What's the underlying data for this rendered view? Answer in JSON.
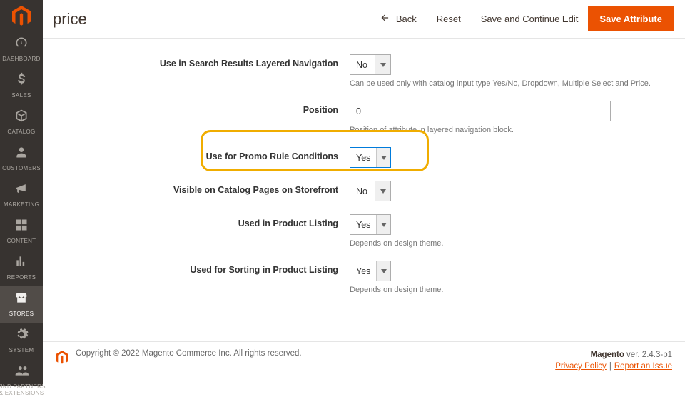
{
  "page": {
    "title": "price"
  },
  "topbar": {
    "back": "Back",
    "reset": "Reset",
    "save_continue": "Save and Continue Edit",
    "save": "Save Attribute"
  },
  "sidenav": [
    {
      "id": "dashboard",
      "label": "DASHBOARD"
    },
    {
      "id": "sales",
      "label": "SALES"
    },
    {
      "id": "catalog",
      "label": "CATALOG"
    },
    {
      "id": "customers",
      "label": "CUSTOMERS"
    },
    {
      "id": "marketing",
      "label": "MARKETING"
    },
    {
      "id": "content",
      "label": "CONTENT"
    },
    {
      "id": "reports",
      "label": "REPORTS"
    },
    {
      "id": "stores",
      "label": "STORES",
      "active": true
    },
    {
      "id": "system",
      "label": "SYSTEM"
    },
    {
      "id": "partners",
      "label": "FIND PARTNERS\n& EXTENSIONS"
    }
  ],
  "form": {
    "search_layered": {
      "label": "Use in Search Results Layered Navigation",
      "value": "No",
      "hint": "Can be used only with catalog input type Yes/No, Dropdown, Multiple Select and Price."
    },
    "position": {
      "label": "Position",
      "value": "0",
      "hint": "Position of attribute in layered navigation block."
    },
    "promo": {
      "label": "Use for Promo Rule Conditions",
      "value": "Yes"
    },
    "visible_catalog": {
      "label": "Visible on Catalog Pages on Storefront",
      "value": "No"
    },
    "product_listing": {
      "label": "Used in Product Listing",
      "value": "Yes",
      "hint": "Depends on design theme."
    },
    "sorting": {
      "label": "Used for Sorting in Product Listing",
      "value": "Yes",
      "hint": "Depends on design theme."
    }
  },
  "footer": {
    "copyright": "Copyright © 2022 Magento Commerce Inc. All rights reserved.",
    "product": "Magento",
    "version_prefix": " ver. ",
    "version": "2.4.3-p1",
    "privacy": "Privacy Policy",
    "report": "Report an Issue"
  }
}
